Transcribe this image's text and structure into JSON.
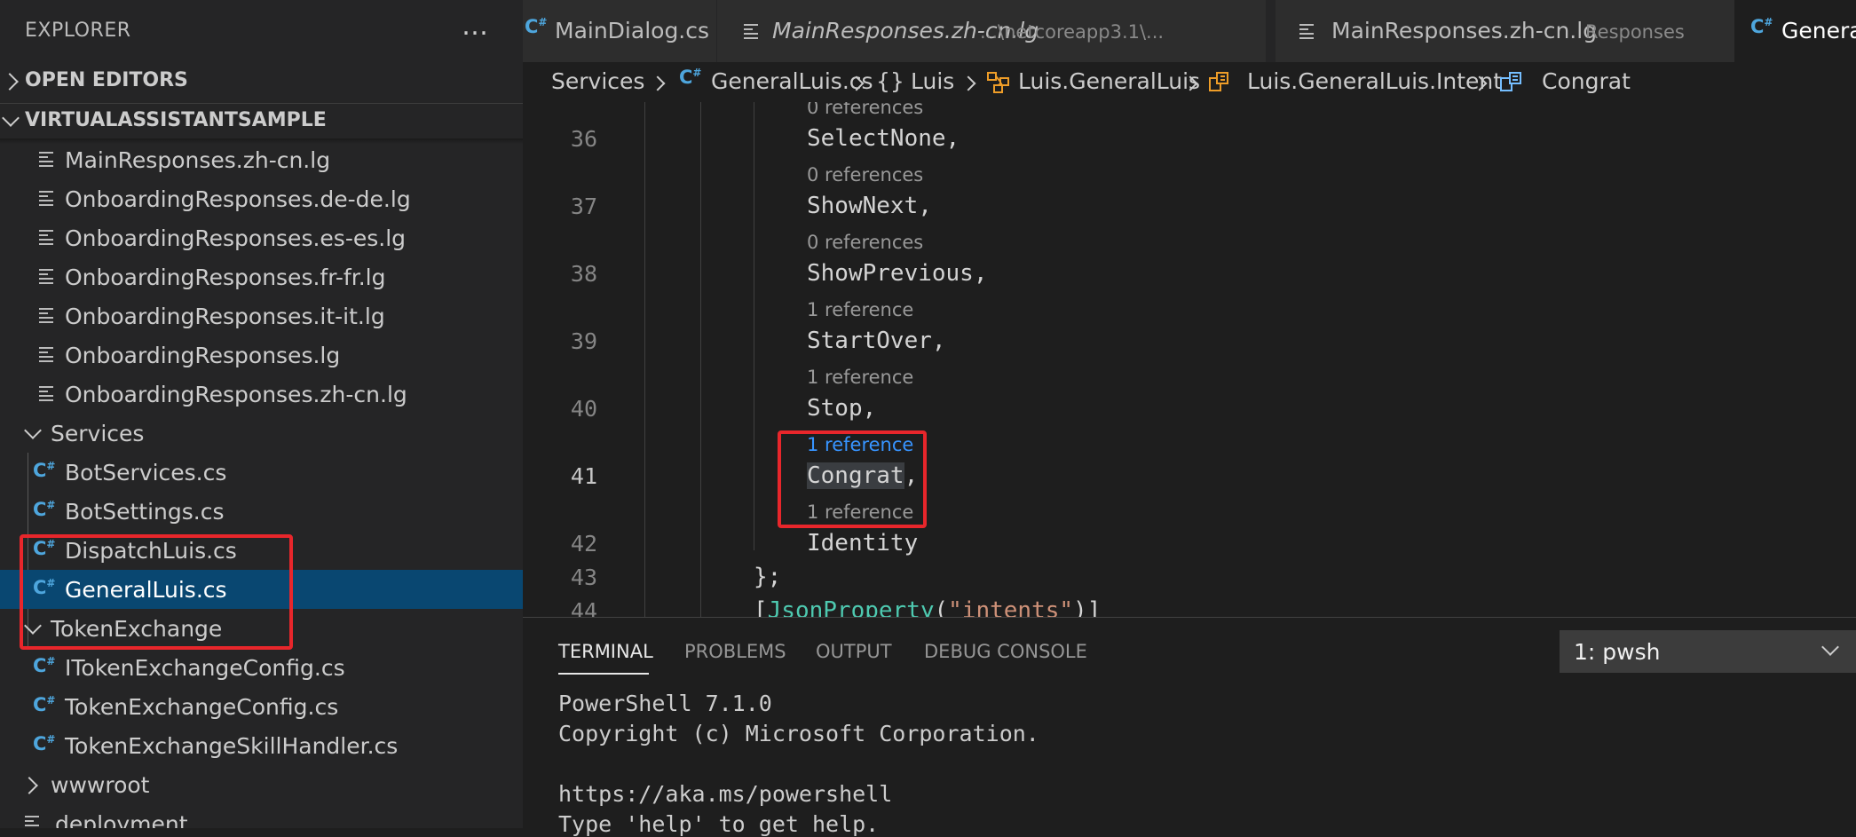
{
  "explorer": {
    "title": "EXPLORER",
    "more_icon": "…",
    "open_editors": "OPEN EDITORS",
    "workspace": "VIRTUALASSISTANTSAMPLE",
    "items": [
      {
        "label": "MainResponses.zh-cn.lg",
        "icon": "lines-file-icon"
      },
      {
        "label": "OnboardingResponses.de-de.lg",
        "icon": "lines-file-icon"
      },
      {
        "label": "OnboardingResponses.es-es.lg",
        "icon": "lines-file-icon"
      },
      {
        "label": "OnboardingResponses.fr-fr.lg",
        "icon": "lines-file-icon"
      },
      {
        "label": "OnboardingResponses.it-it.lg",
        "icon": "lines-file-icon"
      },
      {
        "label": "OnboardingResponses.lg",
        "icon": "lines-file-icon"
      },
      {
        "label": "OnboardingResponses.zh-cn.lg",
        "icon": "lines-file-icon"
      },
      {
        "label": "Services",
        "icon": "folder-open"
      },
      {
        "label": "BotServices.cs",
        "icon": "csharp-icon"
      },
      {
        "label": "BotSettings.cs",
        "icon": "csharp-icon"
      },
      {
        "label": "DispatchLuis.cs",
        "icon": "csharp-icon"
      },
      {
        "label": "GeneralLuis.cs",
        "icon": "csharp-icon",
        "selected": true
      },
      {
        "label": "TokenExchange",
        "icon": "folder-open"
      },
      {
        "label": "ITokenExchangeConfig.cs",
        "icon": "csharp-icon"
      },
      {
        "label": "TokenExchangeConfig.cs",
        "icon": "csharp-icon"
      },
      {
        "label": "TokenExchangeSkillHandler.cs",
        "icon": "csharp-icon"
      },
      {
        "label": "wwwroot",
        "icon": "folder-closed"
      },
      {
        "label": "deployment",
        "icon": "lines-file-icon"
      }
    ]
  },
  "tabs": [
    {
      "name": "MainDialog.cs",
      "desc": "",
      "icon": "csharp-icon"
    },
    {
      "name": "MainResponses.zh-cn.lg",
      "desc": "...\\netcoreapp3.1\\...",
      "icon": "lines-file-icon",
      "italic": true
    },
    {
      "name": "MainResponses.zh-cn.lg",
      "desc": "Responses",
      "icon": "lines-file-icon"
    },
    {
      "name": "GeneralLuis.cs",
      "desc": "",
      "icon": "csharp-icon",
      "active": true
    }
  ],
  "breadcrumb": {
    "services": "Services",
    "file": "GeneralLuis.cs",
    "ns_prefix": "{}",
    "ns": "Luis",
    "class": "Luis.GeneralLuis",
    "enum": "Luis.GeneralLuis.Intent",
    "member": "Congrat"
  },
  "editor": {
    "top_lens": "0 references",
    "lines": [
      {
        "num": "36",
        "code": "SelectNone,",
        "lens_after": "0 references"
      },
      {
        "num": "37",
        "code": "ShowNext,",
        "lens_after": "0 references"
      },
      {
        "num": "38",
        "code": "ShowPrevious,",
        "lens_after": "1 reference"
      },
      {
        "num": "39",
        "code": "StartOver,",
        "lens_after": "1 reference"
      },
      {
        "num": "40",
        "code": "Stop,",
        "lens_after": "1 reference"
      },
      {
        "num": "41",
        "code_word": "Congrat",
        "code_rest": ",",
        "lens_after": "1 reference"
      },
      {
        "num": "42",
        "code": "Identity"
      },
      {
        "num": "43",
        "code": "};"
      },
      {
        "num": "44",
        "code_open": "[",
        "code_attr": "JsonProperty",
        "code_paren": "(",
        "code_str": "\"intents\"",
        "code_close": ")]"
      }
    ]
  },
  "colors": {
    "accent": "#094771",
    "annotation": "#e8262b",
    "link": "#3794ff",
    "csharp": "#4ea6dd"
  },
  "panel": {
    "tabs": [
      "TERMINAL",
      "PROBLEMS",
      "OUTPUT",
      "DEBUG CONSOLE"
    ],
    "active_tab": "TERMINAL",
    "terminal_select": "1: pwsh",
    "terminal_lines": [
      "PowerShell 7.1.0",
      "Copyright (c) Microsoft Corporation.",
      "",
      "https://aka.ms/powershell",
      "Type 'help' to get help."
    ]
  }
}
